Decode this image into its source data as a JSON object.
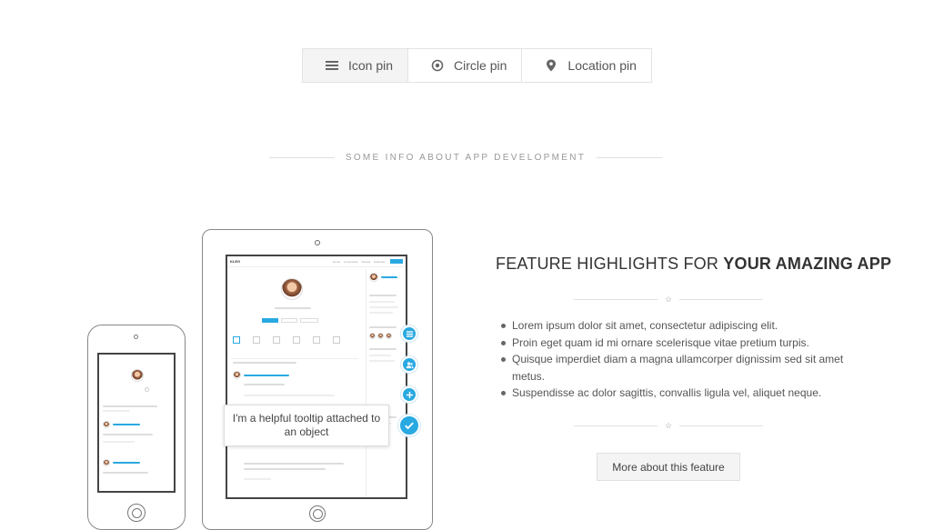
{
  "tabs": [
    {
      "label": "Icon pin",
      "icon": "list-icon",
      "active": true
    },
    {
      "label": "Circle pin",
      "icon": "circle-target-icon",
      "active": false
    },
    {
      "label": "Location pin",
      "icon": "location-pin-icon",
      "active": false
    }
  ],
  "section_title": "SOME INFO ABOUT APP DEVELOPMENT",
  "tooltip": "I'm a helpful tooltip attached to an object",
  "feature": {
    "title_light": "FEATURE HIGHLIGHTS FOR ",
    "title_bold": "YOUR AMAZING APP",
    "bullets": [
      "Lorem ipsum dolor sit amet, consectetur adipiscing elit.",
      "Proin eget quam id mi ornare scelerisque vitae pretium turpis.",
      "Quisque imperdiet diam a magna ullamcorper dignissim sed sit amet metus.",
      "Suspendisse ac dolor sagittis, convallis ligula vel, aliquet neque."
    ],
    "button_label": "More about this feature"
  },
  "mini_app": {
    "logo": "KLEG",
    "nav_links": [
      "Home",
      "Community",
      "Groups",
      "Features",
      "Membership"
    ]
  },
  "colors": {
    "accent": "#29a9e1",
    "text": "#555555",
    "muted": "#999999"
  }
}
